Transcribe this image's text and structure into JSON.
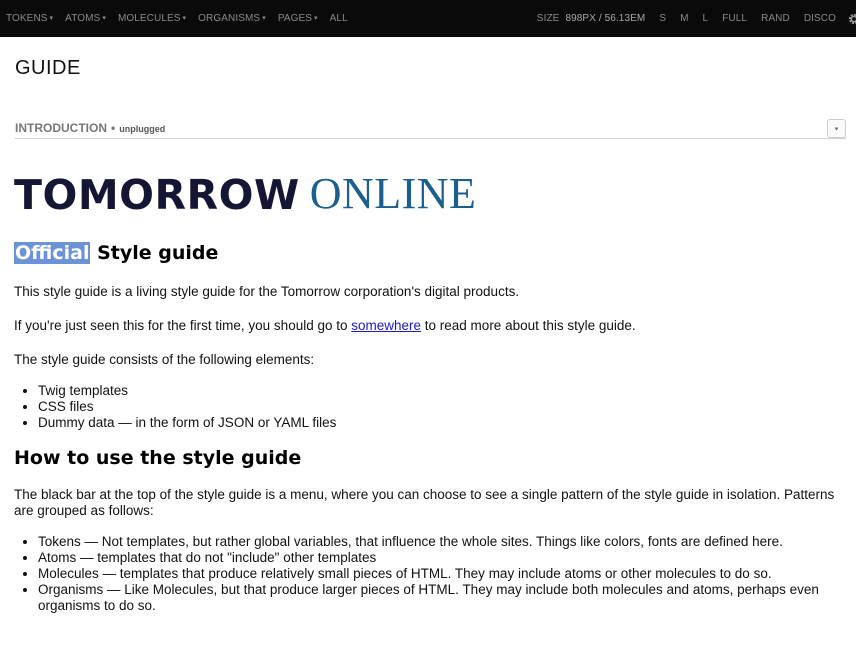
{
  "topbar": {
    "menus": [
      {
        "label": "TOKENS",
        "arrow": "▾"
      },
      {
        "label": "ATOMS",
        "arrow": "▾"
      },
      {
        "label": "MOLECULES",
        "arrow": "▾"
      },
      {
        "label": "ORGANISMS",
        "arrow": "▾"
      },
      {
        "label": "PAGES",
        "arrow": "▾"
      },
      {
        "label": "ALL",
        "arrow": ""
      }
    ],
    "size_label": "SIZE",
    "size_value": "898PX / 56.13EM",
    "size_buttons": [
      "S",
      "M",
      "L",
      "FULL",
      "RAND",
      "DISCO"
    ],
    "settings_icon": "gear-icon",
    "bg_color": "#0a0a0a"
  },
  "guide": {
    "title": "GUIDE"
  },
  "section": {
    "name": "INTRODUCTION",
    "separator": "•",
    "status": "unplugged",
    "toggle_icon": "▾"
  },
  "logo": {
    "bold": "TOMORROW",
    "serif": "ONLINE",
    "bold_color": "#151633",
    "serif_color": "#1b5f8f"
  },
  "intro": {
    "heading_highlight": "Official",
    "heading_rest": " Style guide",
    "p1": "This style guide is a living style guide for the Tomorrow corporation's digital products.",
    "p2_before": "If you're just seen this for the first time, you should go to ",
    "p2_link": "somewhere",
    "p2_after": " to read more about this style guide.",
    "p3": "The style guide consists of the following elements:",
    "elements": [
      "Twig templates",
      "CSS files",
      "Dummy data — in the form of JSON or YAML files"
    ]
  },
  "howto": {
    "heading": "How to use the style guide",
    "p1": "The black bar at the top of the style guide is a menu, where you can choose to see a single pattern of the style guide in isolation. Patterns are grouped as follows:",
    "groups": [
      "Tokens — Not templates, but rather global variables, that influence the whole sites. Things like colors, fonts are defined here.",
      "Atoms — templates that do not \"include\" other templates",
      "Molecules — templates that produce relatively small pieces of HTML. They may include atoms or other molecules to do so.",
      "Organisms — Like Molecules, but that produce larger pieces of HTML. They may include both molecules and atoms, perhaps even organisms to do so."
    ]
  }
}
